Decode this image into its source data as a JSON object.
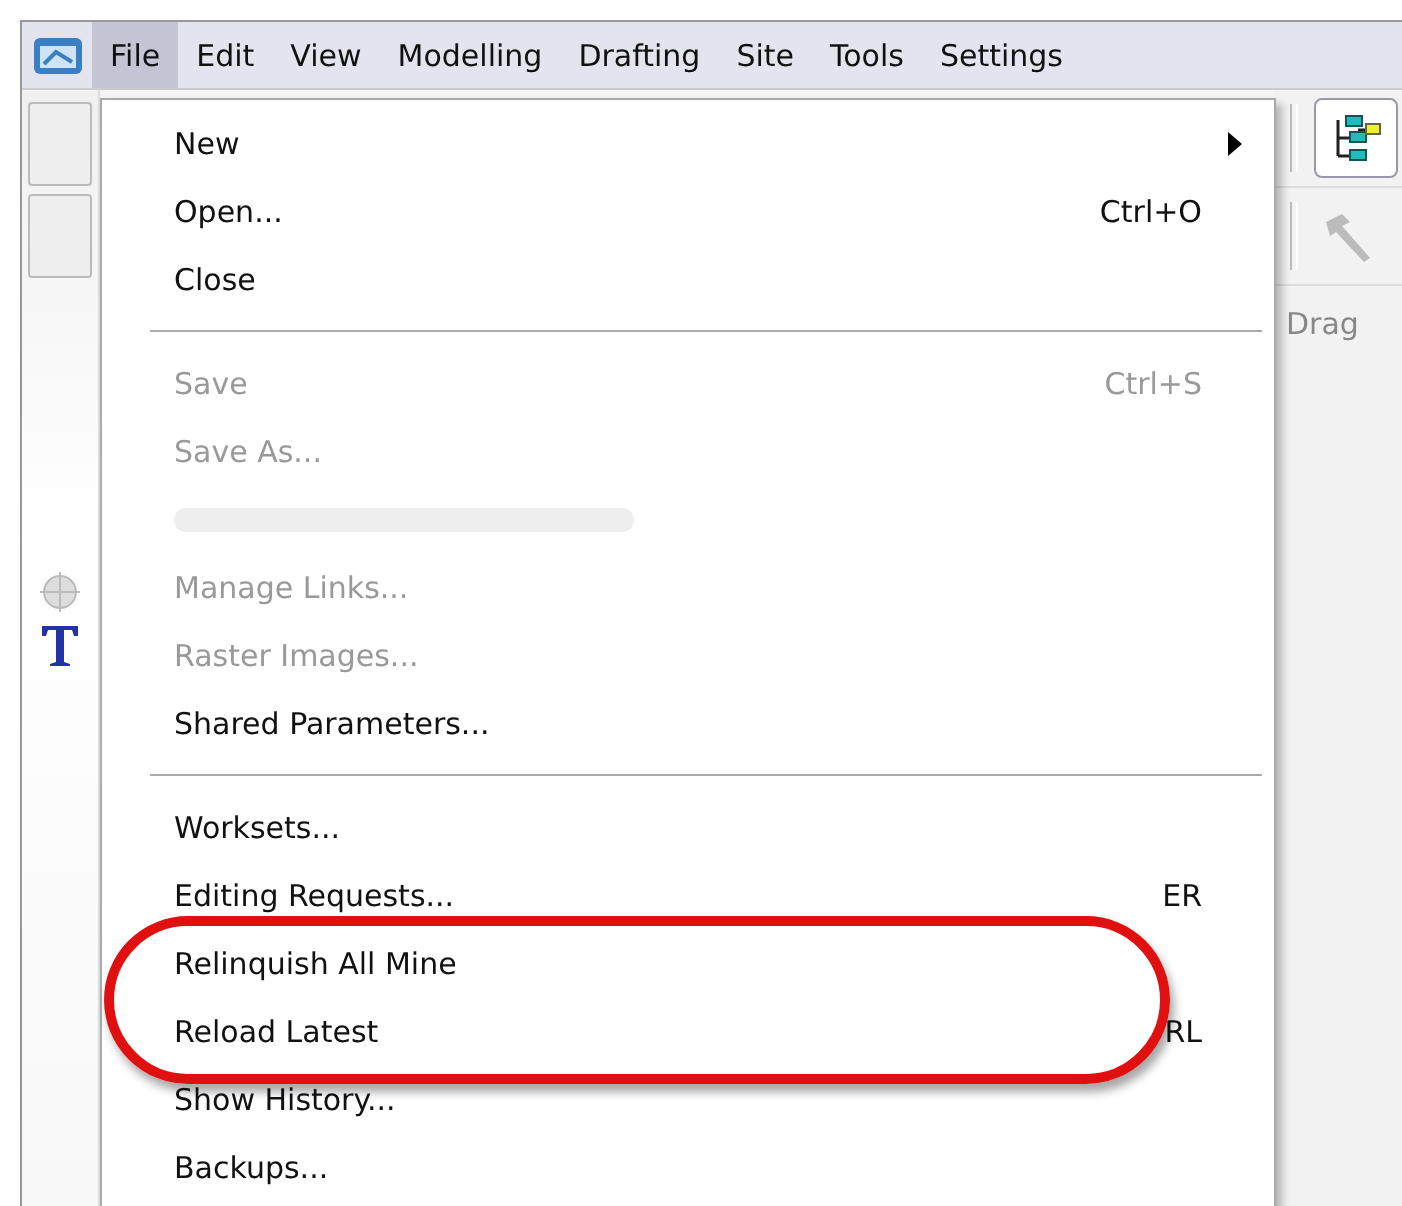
{
  "menubar": {
    "items": [
      {
        "label": "File",
        "selected": true
      },
      {
        "label": "Edit",
        "selected": false
      },
      {
        "label": "View",
        "selected": false
      },
      {
        "label": "Modelling",
        "selected": false
      },
      {
        "label": "Drafting",
        "selected": false
      },
      {
        "label": "Site",
        "selected": false
      },
      {
        "label": "Tools",
        "selected": false
      },
      {
        "label": "Settings",
        "selected": false
      }
    ]
  },
  "menu": {
    "items": [
      {
        "kind": "item",
        "label": "New",
        "submenu": true,
        "disabled": false,
        "highlighted": false
      },
      {
        "kind": "item",
        "label": "Open...",
        "shortcut": "Ctrl+O",
        "disabled": false,
        "highlighted": false
      },
      {
        "kind": "item",
        "label": "Close",
        "disabled": false,
        "highlighted": false
      },
      {
        "kind": "separator"
      },
      {
        "kind": "item",
        "label": "Save",
        "shortcut": "Ctrl+S",
        "disabled": true,
        "highlighted": false
      },
      {
        "kind": "item",
        "label": "Save As...",
        "disabled": true,
        "highlighted": false
      },
      {
        "kind": "blurred"
      },
      {
        "kind": "item",
        "label": "Manage Links...",
        "disabled": true,
        "highlighted": false
      },
      {
        "kind": "item",
        "label": "Raster Images...",
        "disabled": true,
        "highlighted": false
      },
      {
        "kind": "item",
        "label": "Shared Parameters...",
        "disabled": false,
        "highlighted": false
      },
      {
        "kind": "separator"
      },
      {
        "kind": "item",
        "label": "Worksets...",
        "disabled": false,
        "highlighted": false
      },
      {
        "kind": "item",
        "label": "Editing Requests...",
        "shortcut": "ER",
        "disabled": false,
        "highlighted": false
      },
      {
        "kind": "item",
        "label": "Relinquish All Mine",
        "disabled": false,
        "highlighted": true
      },
      {
        "kind": "item",
        "label": "Reload Latest",
        "shortcut": "RL",
        "disabled": false,
        "highlighted": true
      },
      {
        "kind": "item",
        "label": "Show History...",
        "disabled": false,
        "highlighted": false
      },
      {
        "kind": "item",
        "label": "Backups...",
        "disabled": false,
        "highlighted": false
      }
    ]
  },
  "side_panel": {
    "label": "Drag"
  }
}
